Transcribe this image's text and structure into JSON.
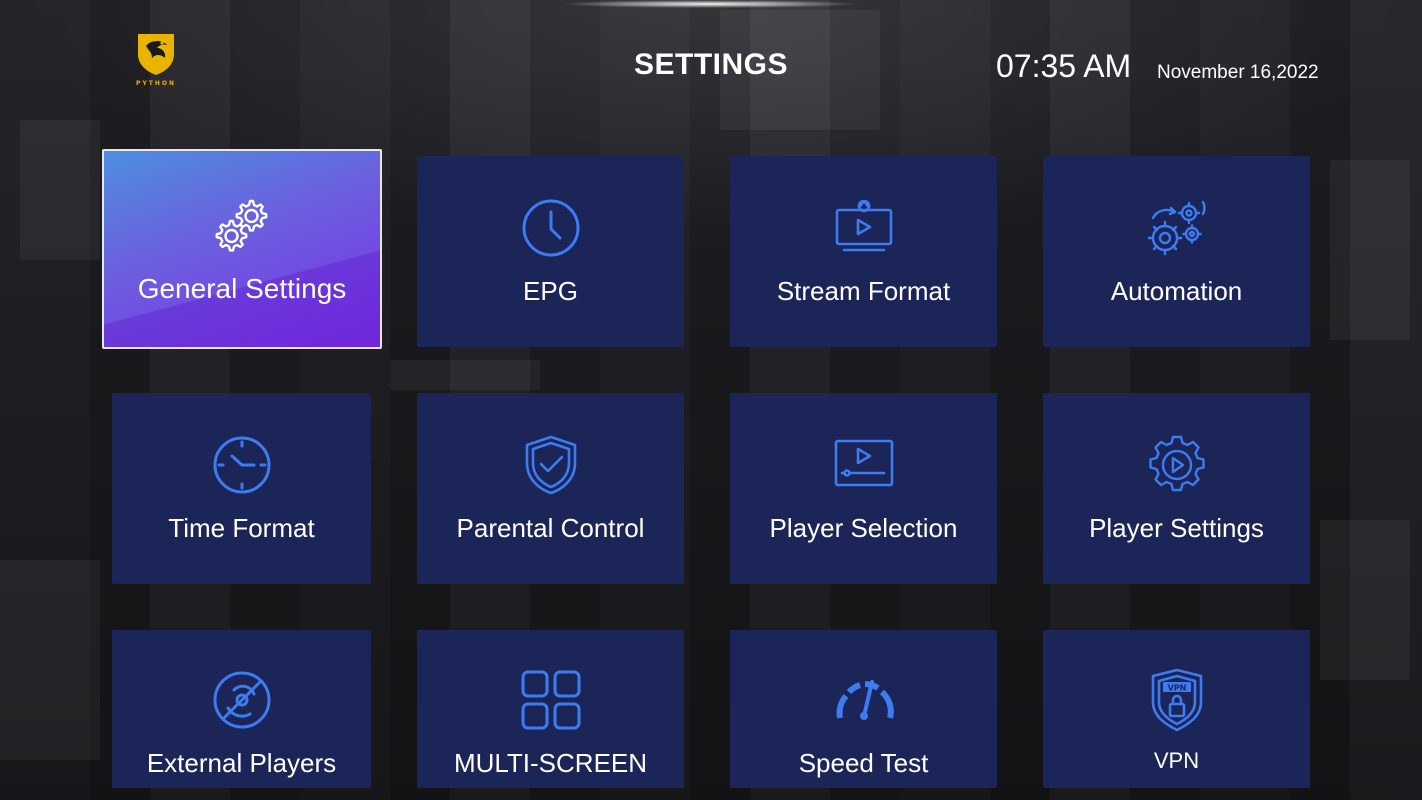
{
  "header": {
    "logo_text": "PYTHON",
    "title": "SETTINGS",
    "time": "07:35 AM",
    "date": "November 16,2022"
  },
  "colors": {
    "tile_bg": "#1c2558",
    "icon_blue": "#3d7cf0",
    "active_gradient_start": "#4d8fe0",
    "active_gradient_end": "#7d2ee8",
    "logo_gold": "#e8b400"
  },
  "tiles": [
    {
      "label": "General Settings",
      "icon": "gear-icon",
      "selected": true
    },
    {
      "label": "EPG",
      "icon": "clock-icon",
      "selected": false
    },
    {
      "label": "Stream Format",
      "icon": "stream-icon",
      "selected": false
    },
    {
      "label": "Automation",
      "icon": "gears-icon",
      "selected": false
    },
    {
      "label": "Time Format",
      "icon": "time-icon",
      "selected": false
    },
    {
      "label": "Parental Control",
      "icon": "shield-check-icon",
      "selected": false
    },
    {
      "label": "Player Selection",
      "icon": "player-icon",
      "selected": false
    },
    {
      "label": "Player Settings",
      "icon": "play-gear-icon",
      "selected": false
    },
    {
      "label": "External Players",
      "icon": "disc-icon",
      "selected": false
    },
    {
      "label": "MULTI-SCREEN",
      "icon": "grid-icon",
      "selected": false
    },
    {
      "label": "Speed Test",
      "icon": "speedometer-icon",
      "selected": false
    },
    {
      "label": "VPN",
      "icon": "vpn-shield-icon",
      "selected": false
    }
  ]
}
